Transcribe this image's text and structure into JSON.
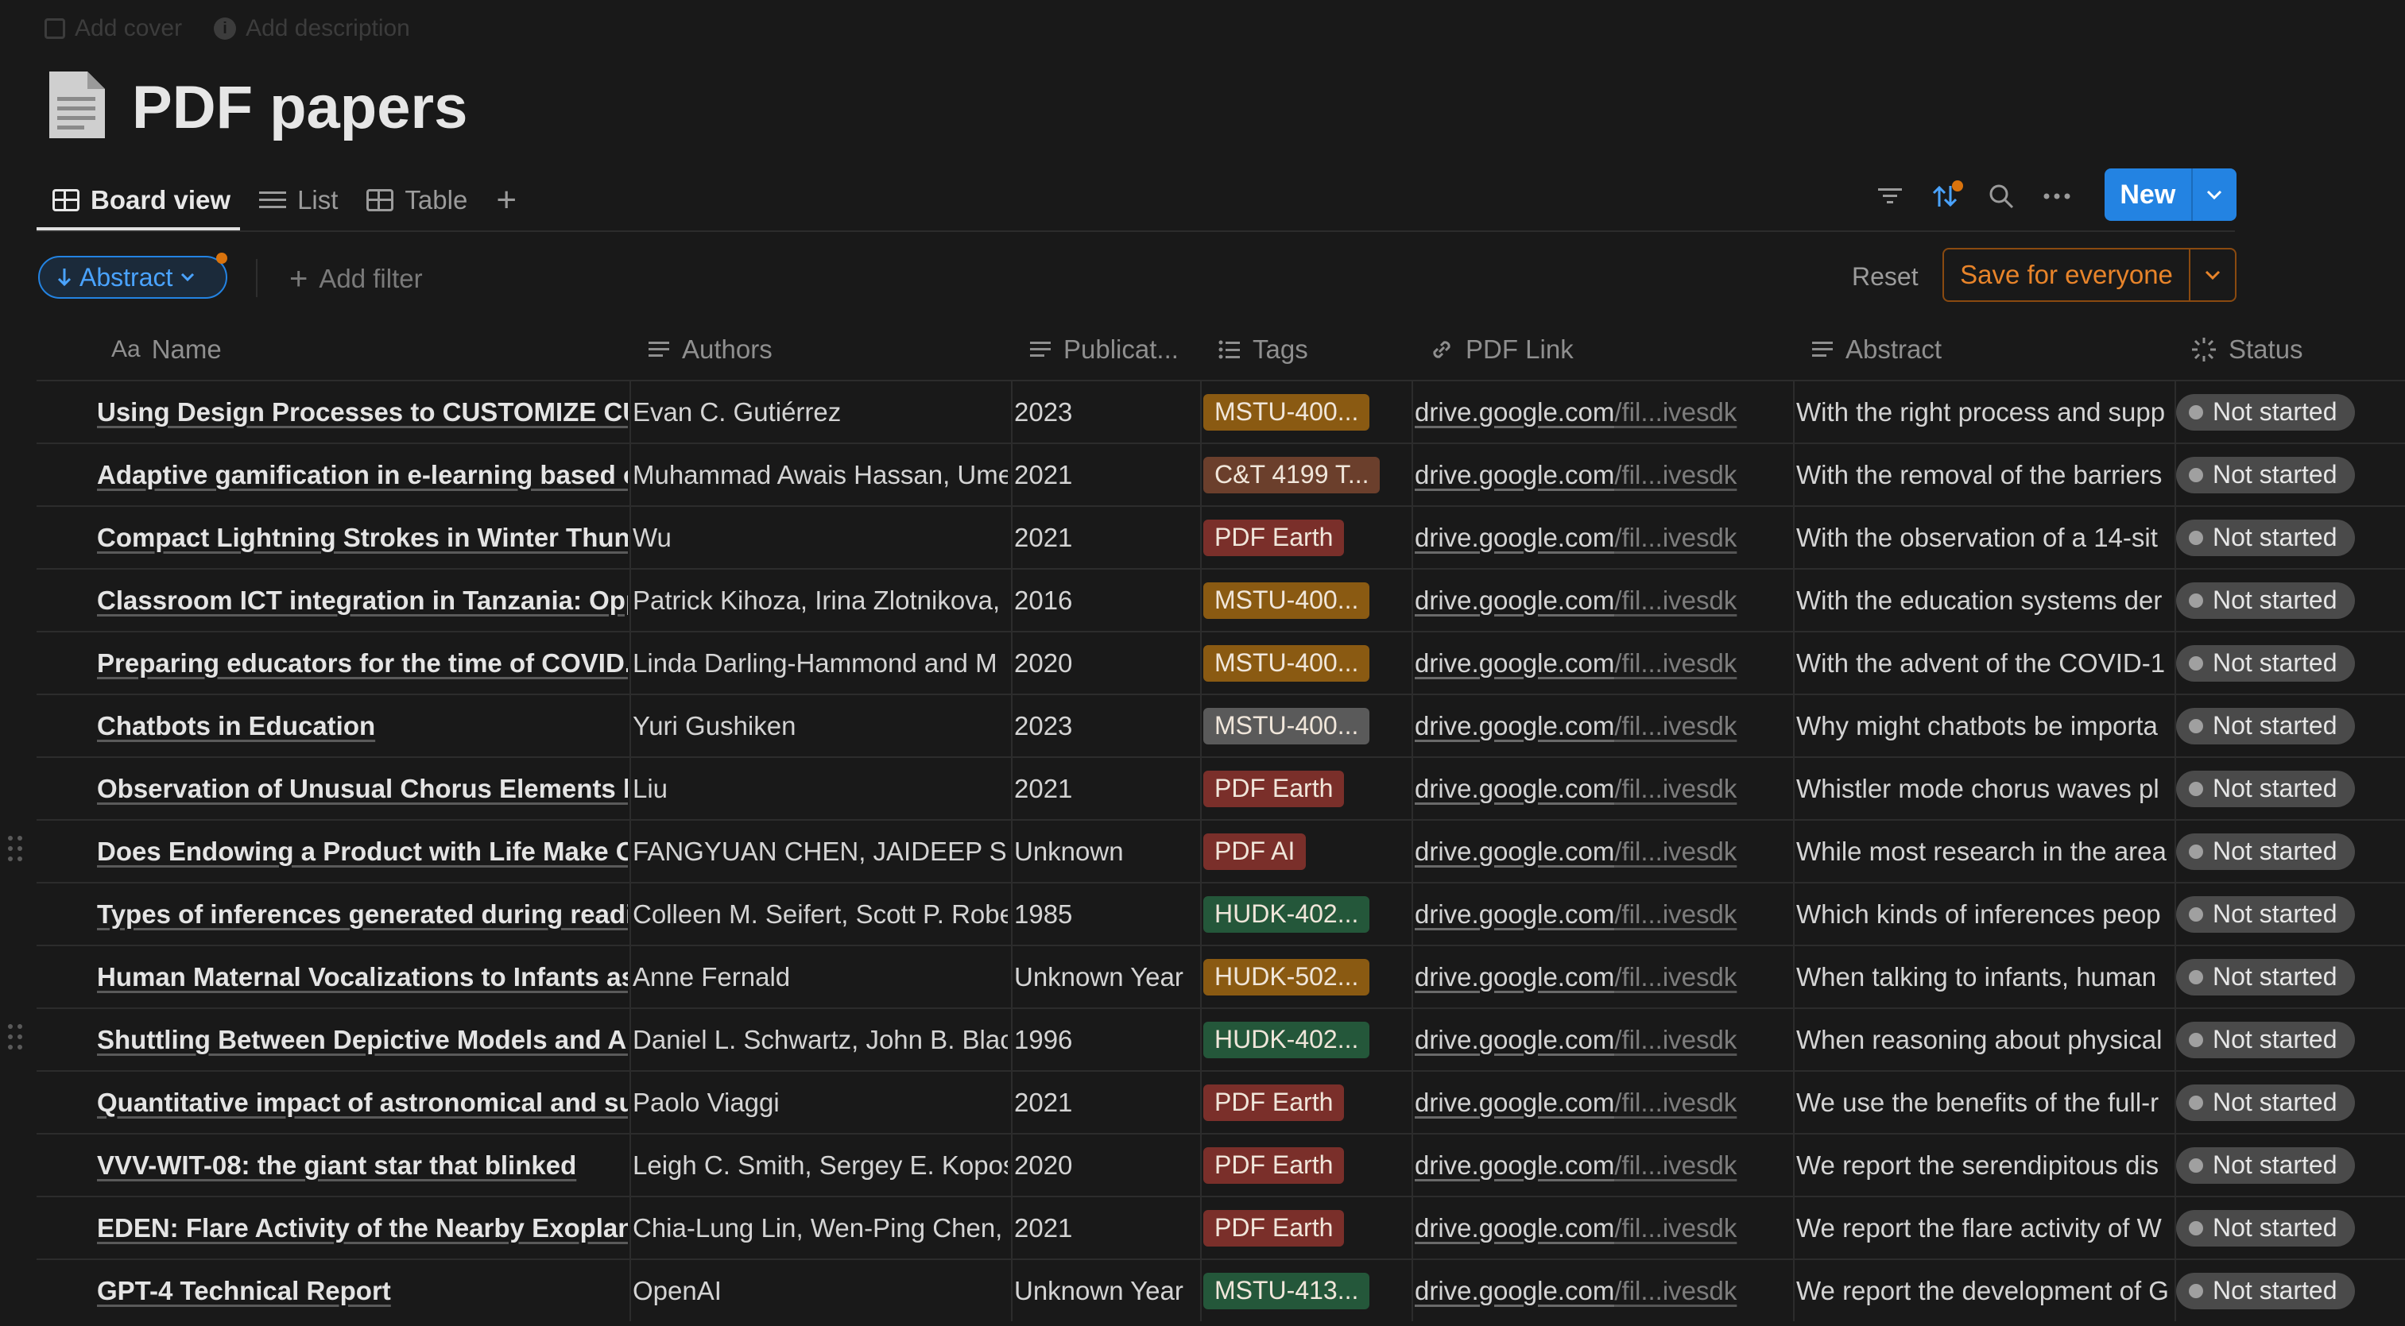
{
  "top": {
    "add_cover": "Add cover",
    "add_description": "Add description"
  },
  "page": {
    "title": "PDF papers",
    "icon": "document-icon"
  },
  "tabs": [
    {
      "label": "Board view",
      "icon": "table-icon",
      "active": true
    },
    {
      "label": "List",
      "icon": "list-icon",
      "active": false
    },
    {
      "label": "Table",
      "icon": "table-icon",
      "active": false
    }
  ],
  "toolbar": {
    "new_label": "New"
  },
  "filters": {
    "sort_chip": "Abstract",
    "add_filter": "Add filter",
    "reset": "Reset",
    "save_label": "Save for everyone"
  },
  "columns": [
    {
      "label": "Name",
      "icon": "Aa"
    },
    {
      "label": "Authors",
      "icon": "text-icon"
    },
    {
      "label": "Publicat...",
      "icon": "text-icon"
    },
    {
      "label": "Tags",
      "icon": "multiselect-icon"
    },
    {
      "label": "PDF Link",
      "icon": "link-icon"
    },
    {
      "label": "Abstract",
      "icon": "text-icon"
    },
    {
      "label": "Status",
      "icon": "status-icon"
    }
  ],
  "colors": {
    "tag_orange": "#8a5a12",
    "tag_brown": "#6b3f2c",
    "tag_red": "#7a2f2a",
    "tag_gray": "#5a5a5a",
    "tag_green": "#24573a",
    "accent": "#2383e2"
  },
  "rows": [
    {
      "name": "Using Design Processes to CUSTOMIZE CUR",
      "authors": "Evan C. Gutiérrez",
      "year": "2023",
      "tag": "MSTU-400...",
      "tag_color": "#8a5a12",
      "link_domain": "drive.google.com",
      "link_path": "/fil...ivesdk",
      "abstract": "With the right process and supp",
      "status": "Not started"
    },
    {
      "name": "Adaptive gamification in e-learning based or",
      "authors": "Muhammad Awais Hassan, Ume",
      "year": "2021",
      "tag": "C&T 4199 T...",
      "tag_color": "#6b3f2c",
      "link_domain": "drive.google.com",
      "link_path": "/fil...ivesdk",
      "abstract": "With the removal of the barriers",
      "status": "Not started"
    },
    {
      "name": "Compact Lightning Strokes in Winter Thunde",
      "authors": "Wu",
      "year": "2021",
      "tag": "PDF Earth",
      "tag_color": "#7a2f2a",
      "link_domain": "drive.google.com",
      "link_path": "/fil...ivesdk",
      "abstract": "With the observation of a 14-sit",
      "status": "Not started"
    },
    {
      "name": "Classroom ICT integration in Tanzania: Oppo",
      "authors": "Patrick Kihoza, Irina Zlotnikova,",
      "year": "2016",
      "tag": "MSTU-400...",
      "tag_color": "#8a5a12",
      "link_domain": "drive.google.com",
      "link_path": "/fil...ivesdk",
      "abstract": "With the education systems der",
      "status": "Not started"
    },
    {
      "name": "Preparing educators for the time of COVID...",
      "authors": "Linda Darling-Hammond and M",
      "year": "2020",
      "tag": "MSTU-400...",
      "tag_color": "#8a5a12",
      "link_domain": "drive.google.com",
      "link_path": "/fil...ivesdk",
      "abstract": "With the advent of the COVID-1",
      "status": "Not started"
    },
    {
      "name": "Chatbots in Education",
      "authors": "Yuri Gushiken",
      "year": "2023",
      "tag": "MSTU-400...",
      "tag_color": "#5a5a5a",
      "link_domain": "drive.google.com",
      "link_path": "/fil...ivesdk",
      "abstract": "Why might chatbots be importa",
      "status": "Not started"
    },
    {
      "name": "Observation of Unusual Chorus Elements by",
      "authors": "Liu",
      "year": "2021",
      "tag": "PDF Earth",
      "tag_color": "#7a2f2a",
      "link_domain": "drive.google.com",
      "link_path": "/fil...ivesdk",
      "abstract": "Whistler mode chorus waves pl",
      "status": "Not started"
    },
    {
      "name": "Does Endowing a Product with Life Make On",
      "authors": "FANGYUAN CHEN, JAIDEEP SEN",
      "year": "Unknown",
      "tag": "PDF AI",
      "tag_color": "#7a2f2a",
      "link_domain": "drive.google.com",
      "link_path": "/fil...ivesdk",
      "abstract": "While most research in the area",
      "status": "Not started"
    },
    {
      "name": "Types of inferences generated during readin",
      "authors": "Colleen M. Seifert, Scott P. Robe",
      "year": "1985",
      "tag": "HUDK-402...",
      "tag_color": "#24573a",
      "link_domain": "drive.google.com",
      "link_path": "/fil...ivesdk",
      "abstract": "Which kinds of inferences peop",
      "status": "Not started"
    },
    {
      "name": "Human Maternal Vocalizations to Infants as I",
      "authors": "Anne Fernald",
      "year": "Unknown Year",
      "tag": "HUDK-502...",
      "tag_color": "#8a5a12",
      "link_domain": "drive.google.com",
      "link_path": "/fil...ivesdk",
      "abstract": "When talking to infants, human",
      "status": "Not started"
    },
    {
      "name": "Shuttling Between Depictive Models and Abs",
      "authors": "Daniel L. Schwartz, John B. Black",
      "year": "1996",
      "tag": "HUDK-402...",
      "tag_color": "#24573a",
      "link_domain": "drive.google.com",
      "link_path": "/fil...ivesdk",
      "abstract": "When reasoning about physical",
      "status": "Not started"
    },
    {
      "name": "Quantitative impact of astronomical and sun",
      "authors": "Paolo Viaggi",
      "year": "2021",
      "tag": "PDF Earth",
      "tag_color": "#7a2f2a",
      "link_domain": "drive.google.com",
      "link_path": "/fil...ivesdk",
      "abstract": "We use the benefits of the full-r",
      "status": "Not started"
    },
    {
      "name": "VVV-WIT-08: the giant star that blinked",
      "authors": "Leigh C. Smith, Sergey E. Kopos",
      "year": "2020",
      "tag": "PDF Earth",
      "tag_color": "#7a2f2a",
      "link_domain": "drive.google.com",
      "link_path": "/fil...ivesdk",
      "abstract": "We report the serendipitous dis",
      "status": "Not started"
    },
    {
      "name": "EDEN: Flare Activity of the Nearby Exoplanet",
      "authors": "Chia-Lung Lin, Wen-Ping Chen,",
      "year": "2021",
      "tag": "PDF Earth",
      "tag_color": "#7a2f2a",
      "link_domain": "drive.google.com",
      "link_path": "/fil...ivesdk",
      "abstract": "We report the flare activity of W",
      "status": "Not started"
    },
    {
      "name": "GPT-4 Technical Report",
      "authors": "OpenAI",
      "year": "Unknown Year",
      "tag": "MSTU-413...",
      "tag_color": "#24573a",
      "link_domain": "drive.google.com",
      "link_path": "/fil...ivesdk",
      "abstract": "We report the development of G",
      "status": "Not started"
    }
  ]
}
